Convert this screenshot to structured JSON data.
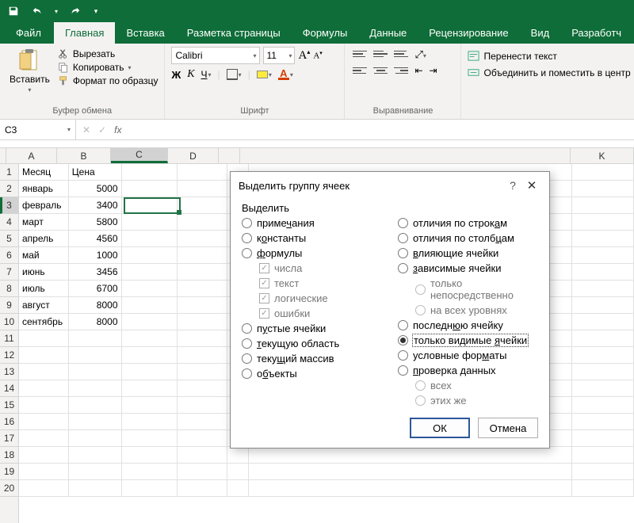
{
  "titlebar": {
    "save_tip": "save",
    "undo_tip": "undo",
    "redo_tip": "redo",
    "customize_tip": "customize"
  },
  "tabs": {
    "file": "Файл",
    "home": "Главная",
    "insert": "Вставка",
    "layout": "Разметка страницы",
    "formulas": "Формулы",
    "data": "Данные",
    "review": "Рецензирование",
    "view": "Вид",
    "dev": "Разработч"
  },
  "ribbon": {
    "clipboard": {
      "paste": "Вставить",
      "cut": "Вырезать",
      "copy": "Копировать",
      "format_painter": "Формат по образцу",
      "label": "Буфер обмена"
    },
    "font": {
      "name": "Calibri",
      "size": "11",
      "label": "Шрифт",
      "bold": "Ж",
      "italic": "К",
      "underline": "Ч",
      "increase": "A",
      "decrease": "A"
    },
    "alignment": {
      "label": "Выравнивание",
      "wrap": "Перенести текст",
      "merge": "Объединить и поместить в центр"
    }
  },
  "formula_bar": {
    "cell_ref": "C3",
    "fx": "fx"
  },
  "columns": [
    "A",
    "B",
    "C",
    "D",
    "",
    "",
    "K"
  ],
  "sheet": {
    "header": {
      "A": "Месяц",
      "B": "Цена"
    },
    "rows": [
      {
        "A": "январь",
        "B": "5000"
      },
      {
        "A": "февраль",
        "B": "3400"
      },
      {
        "A": "март",
        "B": "5800"
      },
      {
        "A": "апрель",
        "B": "4560"
      },
      {
        "A": "май",
        "B": "1000"
      },
      {
        "A": "июнь",
        "B": "3456"
      },
      {
        "A": "июль",
        "B": "6700"
      },
      {
        "A": "август",
        "B": "8000"
      },
      {
        "A": "сентябрь",
        "B": "8000"
      }
    ],
    "selected_cell": "C3"
  },
  "dialog": {
    "title": "Выделить группу ячеек",
    "help": "?",
    "close": "✕",
    "group_label": "Выделить",
    "left": {
      "comments": "примечания",
      "constants": "константы",
      "formulas": "формулы",
      "numbers": "числа",
      "text": "текст",
      "logicals": "логические",
      "errors": "ошибки",
      "blanks": "пустые ячейки",
      "current_region": "текущую область",
      "current_array": "текущий массив",
      "objects": "объекты"
    },
    "right": {
      "row_diffs": "отличия по строкам",
      "col_diffs": "отличия по столбцам",
      "precedents": "влияющие ячейки",
      "dependents": "зависимые ячейки",
      "direct_only": "только непосредственно",
      "all_levels": "на всех уровнях",
      "last_cell": "последнюю ячейку",
      "visible_only": "только видимые ячейки",
      "cond_formats": "условные форматы",
      "data_validation": "проверка данных",
      "all": "всех",
      "same": "этих же"
    },
    "selected_option": "visible_only",
    "buttons": {
      "ok": "ОК",
      "cancel": "Отмена"
    }
  }
}
